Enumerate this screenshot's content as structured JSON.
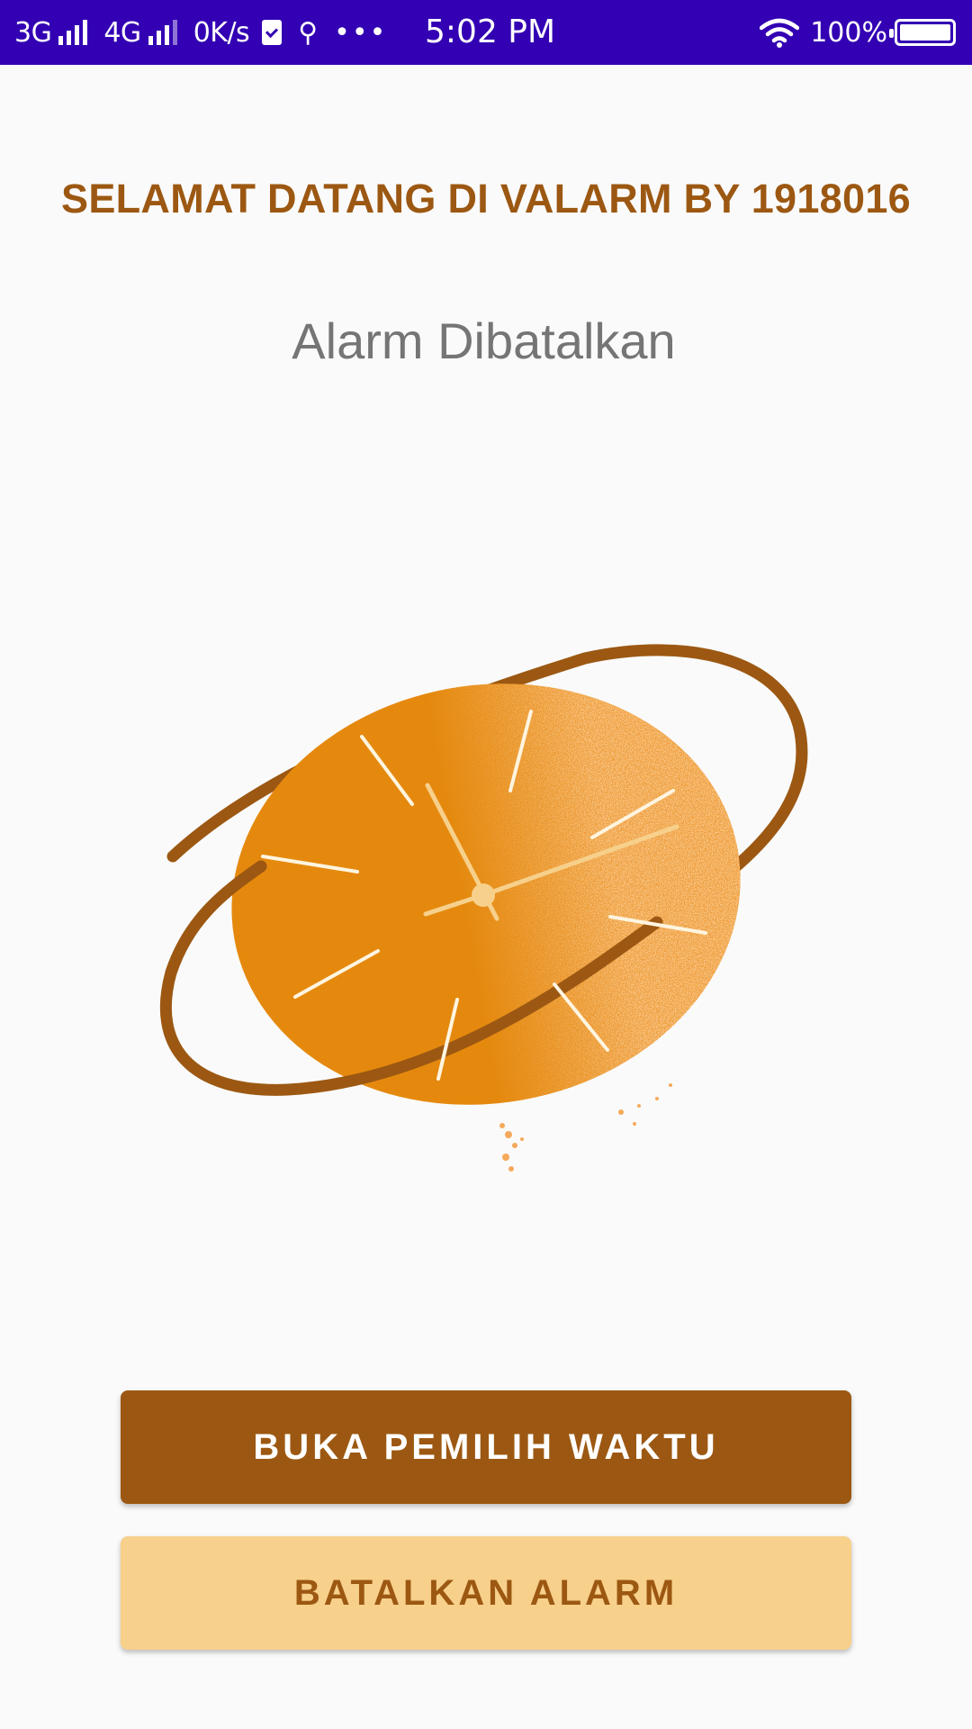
{
  "status_bar": {
    "network1": "3G",
    "network2": "4G",
    "speed": "0K/s",
    "time": "5:02 PM",
    "battery": "100%"
  },
  "app": {
    "welcome": "SELAMAT DATANG DI VALARM BY 1918016",
    "status": "Alarm Dibatalkan"
  },
  "buttons": {
    "open_picker": "BUKA PEMILIH WAKTU",
    "cancel_alarm": "BATALKAN ALARM"
  },
  "colors": {
    "status_bar": "#3300b3",
    "primary": "#9c5812",
    "clock_face": "#e5890e",
    "secondary_button": "#f7d08b"
  },
  "illustration": {
    "icon": "clock-illustration"
  }
}
